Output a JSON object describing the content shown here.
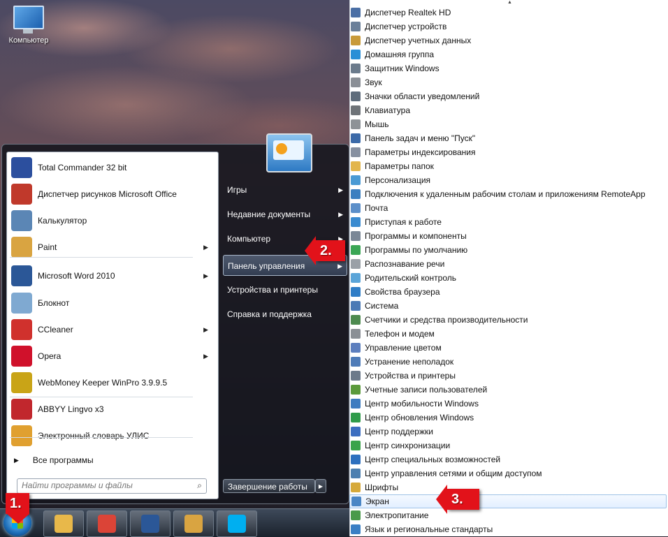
{
  "desktop": {
    "computer_label": "Компьютер"
  },
  "start_menu": {
    "programs": [
      {
        "label": "Total Commander 32 bit",
        "icon": "floppy-icon",
        "color": "#2c4f9e",
        "submenu": false
      },
      {
        "label": "Диспетчер рисунков Microsoft Office",
        "icon": "picture-manager-icon",
        "color": "#c0392b",
        "submenu": false
      },
      {
        "label": "Калькулятор",
        "icon": "calculator-icon",
        "color": "#5b86b5",
        "submenu": false
      },
      {
        "label": "Paint",
        "icon": "palette-icon",
        "color": "#d9a441",
        "submenu": true
      },
      {
        "label": "Microsoft Word 2010",
        "icon": "word-icon",
        "color": "#2b5797",
        "submenu": true
      },
      {
        "label": "Блокнот",
        "icon": "notepad-icon",
        "color": "#7fa9d1",
        "submenu": false
      },
      {
        "label": "CCleaner",
        "icon": "ccleaner-icon",
        "color": "#d0312d",
        "submenu": true
      },
      {
        "label": "Opera",
        "icon": "opera-icon",
        "color": "#d0112b",
        "submenu": true
      },
      {
        "label": "WebMoney Keeper WinPro 3.9.9.5",
        "icon": "webmoney-icon",
        "color": "#c9a417",
        "submenu": false
      },
      {
        "label": "ABBYY Lingvo x3",
        "icon": "book-icon",
        "color": "#c1272d",
        "submenu": false
      },
      {
        "label": "Электронный словарь УЛИС",
        "icon": "dictionary-icon",
        "color": "#e0a030",
        "submenu": false
      }
    ],
    "all_programs": "Все программы",
    "search_placeholder": "Найти программы и файлы",
    "right_items": [
      {
        "label": "Игры",
        "submenu": true
      },
      {
        "label": "Недавние документы",
        "submenu": true
      },
      {
        "label": "Компьютер",
        "submenu": true
      },
      {
        "label": "Панель управления",
        "submenu": true
      },
      {
        "label": "Устройства и принтеры",
        "submenu": false
      },
      {
        "label": "Справка и поддержка",
        "submenu": false
      }
    ],
    "shutdown": "Завершение работы"
  },
  "taskbar": {
    "apps": [
      {
        "name": "explorer",
        "icon": "folder-icon",
        "color": "#e8b84a"
      },
      {
        "name": "chrome",
        "icon": "chrome-icon",
        "color": "#db4437"
      },
      {
        "name": "word",
        "icon": "word-icon",
        "color": "#2b5797"
      },
      {
        "name": "paint",
        "icon": "palette-icon",
        "color": "#d9a441"
      },
      {
        "name": "skype",
        "icon": "skype-icon",
        "color": "#00aff0"
      }
    ]
  },
  "control_panel": {
    "items": [
      {
        "label": "Диспетчер Realtek HD",
        "color": "#4a6fa5"
      },
      {
        "label": "Диспетчер устройств",
        "color": "#6a7f99"
      },
      {
        "label": "Диспетчер учетных данных",
        "color": "#c89a3a"
      },
      {
        "label": "Домашняя группа",
        "color": "#2a8fd6"
      },
      {
        "label": "Защитник Windows",
        "color": "#6b7b8c"
      },
      {
        "label": "Звук",
        "color": "#8a8f96"
      },
      {
        "label": "Значки области уведомлений",
        "color": "#5e6c7b"
      },
      {
        "label": "Клавиатура",
        "color": "#6e7378"
      },
      {
        "label": "Мышь",
        "color": "#8d9297"
      },
      {
        "label": "Панель задач и меню \"Пуск\"",
        "color": "#3c6aa8"
      },
      {
        "label": "Параметры индексирования",
        "color": "#8790a0"
      },
      {
        "label": "Параметры папок",
        "color": "#e2b54b"
      },
      {
        "label": "Персонализация",
        "color": "#4a9ad4"
      },
      {
        "label": "Подключения к удаленным рабочим столам и приложениям RemoteApp",
        "color": "#3c7fc0"
      },
      {
        "label": "Почта",
        "color": "#5c8fc9"
      },
      {
        "label": "Приступая к работе",
        "color": "#3a8bd0"
      },
      {
        "label": "Программы и компоненты",
        "color": "#7a8796"
      },
      {
        "label": "Программы по умолчанию",
        "color": "#3aa655"
      },
      {
        "label": "Распознавание речи",
        "color": "#9aa0a7"
      },
      {
        "label": "Родительский контроль",
        "color": "#5aa4d8"
      },
      {
        "label": "Свойства браузера",
        "color": "#2f7dc6"
      },
      {
        "label": "Система",
        "color": "#4a79b5"
      },
      {
        "label": "Счетчики и средства производительности",
        "color": "#4d8a4f"
      },
      {
        "label": "Телефон и модем",
        "color": "#8a8f95"
      },
      {
        "label": "Управление цветом",
        "color": "#5d7fbe"
      },
      {
        "label": "Устранение неполадок",
        "color": "#4f7cb8"
      },
      {
        "label": "Устройства и принтеры",
        "color": "#6c7a8a"
      },
      {
        "label": "Учетные записи пользователей",
        "color": "#5b9a3c"
      },
      {
        "label": "Центр мобильности Windows",
        "color": "#3e7cc0"
      },
      {
        "label": "Центр обновления Windows",
        "color": "#2f9b4a"
      },
      {
        "label": "Центр поддержки",
        "color": "#3c6ec0"
      },
      {
        "label": "Центр синхронизации",
        "color": "#3aa34a"
      },
      {
        "label": "Центр специальных возможностей",
        "color": "#2c6fbe"
      },
      {
        "label": "Центр управления сетями и общим доступом",
        "color": "#4c7fb0"
      },
      {
        "label": "Шрифты",
        "color": "#d6a93a"
      },
      {
        "label": "Экран",
        "color": "#4a86c5"
      },
      {
        "label": "Электропитание",
        "color": "#4a9a4a"
      },
      {
        "label": "Язык и региональные стандарты",
        "color": "#3a7fc4"
      }
    ],
    "highlighted_index": 35
  },
  "markers": {
    "step1": "1.",
    "step2": "2.",
    "step3": "3."
  }
}
